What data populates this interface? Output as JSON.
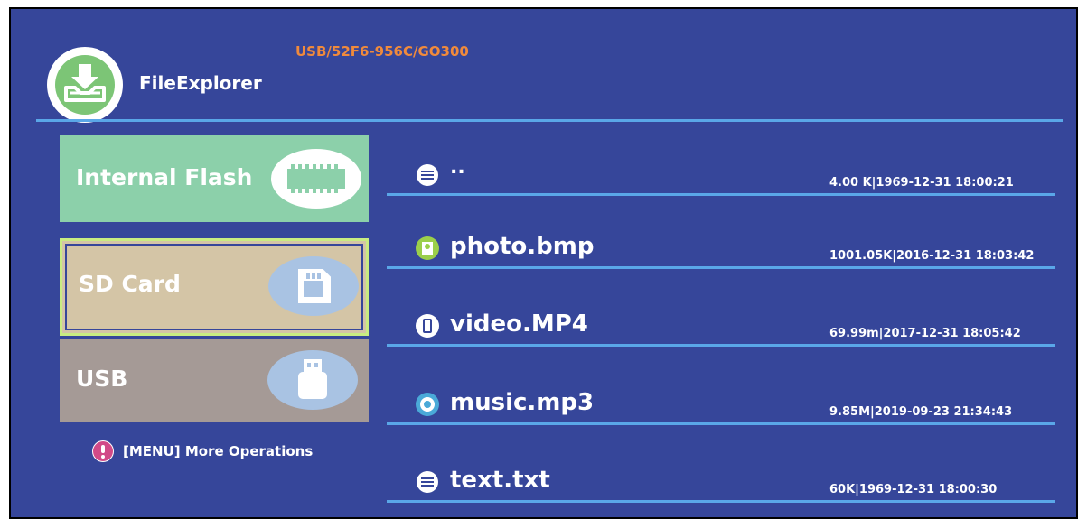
{
  "header": {
    "app_title": "FileExplorer",
    "path": "USB/52F6-956C/GO300"
  },
  "storage": [
    {
      "label": "Internal Flash",
      "icon": "chip-icon",
      "selected": false
    },
    {
      "label": "SD Card",
      "icon": "sd-card-icon",
      "selected": true
    },
    {
      "label": "USB",
      "icon": "usb-drive-icon",
      "selected": false
    }
  ],
  "hint": {
    "text": "[MENU] More Operations",
    "icon": "exclamation-icon"
  },
  "files": [
    {
      "name": "..",
      "meta": "4.00 K|1969-12-31 18:00:21",
      "icon": "folder-icon"
    },
    {
      "name": "photo.bmp",
      "meta": "1001.05K|2016-12-31 18:03:42",
      "icon": "image-icon"
    },
    {
      "name": "video.MP4",
      "meta": "69.99m|2017-12-31 18:05:42",
      "icon": "video-icon"
    },
    {
      "name": "music.mp3",
      "meta": "9.85M|2019-09-23 21:34:43",
      "icon": "music-icon"
    },
    {
      "name": "text.txt",
      "meta": "60K|1969-12-31 18:00:30",
      "icon": "text-file-icon"
    }
  ],
  "colors": {
    "background": "#36469a",
    "accent_line": "#5aa7e8",
    "path_text": "#f08a3c",
    "internal_flash": "#8cd0aa",
    "sd_card": "#d4c5a6",
    "sd_card_border": "#c9ec82",
    "usb": "#a59a96"
  }
}
